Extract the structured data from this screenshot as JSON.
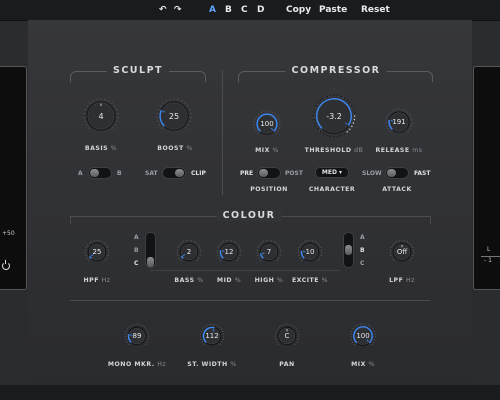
{
  "topbar": {
    "undo_icon": "undo-icon",
    "redo_icon": "redo-icon",
    "presets": [
      "A",
      "B",
      "C",
      "D"
    ],
    "active_preset": "A",
    "copy": "Copy",
    "paste": "Paste",
    "reset": "Reset",
    "active_color": "#5fa8ff"
  },
  "side_left": {
    "meter_value": "+50",
    "power_icon": "power-icon"
  },
  "side_right": {
    "label_l": "L",
    "label_minus": "- 1"
  },
  "sculpt": {
    "title": "SCULPT",
    "basis": {
      "value": "4",
      "label": "BASIS",
      "unit": "%",
      "level": 0.5
    },
    "boost": {
      "value": "25",
      "label": "BOOST",
      "unit": "%",
      "level": 0.25
    },
    "ab_toggle": {
      "left": "A",
      "right": "B",
      "state": "left"
    },
    "sat_clip": {
      "left": "SAT",
      "right": "CLIP",
      "state": "right"
    }
  },
  "compressor": {
    "title": "COMPRESSOR",
    "mix": {
      "value": "100",
      "label": "MIX",
      "unit": "%",
      "level": 1.0
    },
    "threshold": {
      "value": "-3.2",
      "label": "THRESHOLD",
      "unit": "dB",
      "level": 0.95
    },
    "release": {
      "value": "191",
      "label": "RELEASE",
      "unit": "ms",
      "level": 0.2
    },
    "position": {
      "left": "PRE",
      "right": "POST",
      "label": "POSITION",
      "state": "left"
    },
    "character": {
      "value": "MED",
      "label": "CHARACTER"
    },
    "attack": {
      "left": "SLOW",
      "right": "FAST",
      "label": "ATTACK",
      "state": "left"
    }
  },
  "colour": {
    "title": "COLOUR",
    "hpf": {
      "value": "25",
      "label": "HPF",
      "unit": "Hz",
      "level": 0.04
    },
    "bass_switch": {
      "options": [
        "A",
        "B",
        "C"
      ],
      "state": "C"
    },
    "bass_knobs": [
      {
        "value": "2",
        "level": 0.05
      },
      {
        "value": "12",
        "level": 0.2
      },
      {
        "value": "7",
        "level": 0.12
      },
      {
        "value": "10",
        "level": 0.18
      }
    ],
    "bass_label": "BASS",
    "bass_unit": "%",
    "mid_label": "MID",
    "mid_unit": "%",
    "high_label": "HIGH",
    "high_unit": "%",
    "excite_label": "EXCITE",
    "excite_unit": "%",
    "excite_switch": {
      "options": [
        "A",
        "B",
        "C"
      ],
      "state": "B"
    },
    "lpf": {
      "value": "Off",
      "label": "LPF",
      "unit": "Hz",
      "level": 0.5
    }
  },
  "output": {
    "mono": {
      "value": "89",
      "label": "MONO MKR.",
      "unit": "Hz",
      "level": 0.2
    },
    "width": {
      "value": "112",
      "label": "ST. WIDTH",
      "unit": "%",
      "level": 0.55
    },
    "pan": {
      "value": "C",
      "label": "PAN",
      "level": 0.5
    },
    "mix": {
      "value": "100",
      "label": "MIX",
      "unit": "%",
      "level": 1.0
    }
  },
  "colors": {
    "accent": "#3d8cff",
    "knob_face": "#2e2f32",
    "background": "#2b2c2f"
  }
}
